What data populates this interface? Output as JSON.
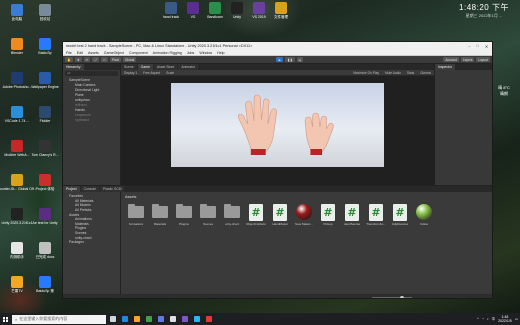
{
  "desktop": {
    "left_icons": [
      {
        "label": "此电脑",
        "color": "#3a7bd5"
      },
      {
        "label": "Blender",
        "color": "#f08a1f"
      },
      {
        "label": "Adobe Photosho...",
        "color": "#1f3b70"
      },
      {
        "label": "VSCode 1.74 ...",
        "color": "#2a8fd8"
      },
      {
        "label": "McAfee WebA...",
        "color": "#c62828"
      },
      {
        "label": "Counter-St... Global Off...",
        "color": "#d9a21b"
      },
      {
        "label": "Unity 2020.3.21f1c1",
        "color": "#222"
      },
      {
        "label": "内测助手",
        "color": "#e6e6e6"
      },
      {
        "label": "芒果TV",
        "color": "#f5a623"
      }
    ],
    "second_icons": [
      {
        "label": "回收站",
        "color": "#7a8a99"
      },
      {
        "label": "BaiduSp",
        "color": "#2979ff"
      },
      {
        "label": "Wallpaper Engine",
        "color": "#2b5aa8"
      },
      {
        "label": "Fiddler",
        "color": "#2c4a6e"
      },
      {
        "label": "Tom Clancy's R...",
        "color": "#333"
      },
      {
        "label": "Project 体验",
        "color": "#c9302c"
      },
      {
        "label": "Ae test for Unity",
        "color": "#5b2d82"
      },
      {
        "label": "已完成 docs",
        "color": "#c0c0c0"
      },
      {
        "label": "BaiduSp 第",
        "color": "#2979ff"
      }
    ],
    "top_icons": [
      {
        "label": "hand track",
        "color": "#3c5a88"
      },
      {
        "label": "VS",
        "color": "#5c2d91"
      },
      {
        "label": "Bandicam",
        "color": "#2a8f4a"
      },
      {
        "label": "Unity",
        "color": "#222"
      },
      {
        "label": "VS 2019",
        "color": "#6a3fa0"
      },
      {
        "label": "文件管理",
        "color": "#d9a21b"
      }
    ],
    "clock_time": "1:48:20 下午",
    "clock_date": "星期三 2022年1月 ...",
    "weather_temp": "晴 8°C",
    "weather_label": "晴朗"
  },
  "unity": {
    "title": "model test 2 hand track - SampleScene - PC, Mac & Linux Standalone - Unity 2020.3.21f1c1 Personal <DX11>",
    "menu": [
      "File",
      "Edit",
      "Assets",
      "GameObject",
      "Component",
      "Animation Rigging",
      "Jobs",
      "Window",
      "Help"
    ],
    "toolbar": {
      "pivot": "Pivot",
      "global": "Global",
      "account": "Account",
      "layers": "Layers",
      "layout": "Layout"
    },
    "hierarchy": {
      "tab": "Hierarchy",
      "search": "All",
      "rows": [
        {
          "label": "SampleScene",
          "indent": false,
          "dim": false
        },
        {
          "label": "Main Camera",
          "indent": true,
          "dim": false
        },
        {
          "label": "Directional Light",
          "indent": true,
          "dim": false
        },
        {
          "label": "Plane",
          "indent": true,
          "dim": false
        },
        {
          "label": "unityuhan",
          "indent": true,
          "dim": false
        },
        {
          "label": "lefthand",
          "indent": true,
          "dim": true
        },
        {
          "label": "Hands",
          "indent": true,
          "dim": false
        },
        {
          "label": "Leapsman",
          "indent": true,
          "dim": true
        },
        {
          "label": "righthand",
          "indent": true,
          "dim": true
        }
      ]
    },
    "scene_tabs": [
      "Scene",
      "Game",
      "Asset Store",
      "Animator"
    ],
    "game_bar": {
      "display": "Display 1",
      "aspect": "Free Aspect",
      "scale": "Scale",
      "maximize": "Maximize On Play",
      "mute": "Mute Audio",
      "stats": "Stats",
      "gizmos": "Gizmos"
    },
    "inspector_tab": "Inspector",
    "project": {
      "tabs": [
        "Project",
        "Console",
        "Plastic SCM"
      ],
      "tree": [
        {
          "label": "Favorites",
          "indent": false
        },
        {
          "label": "All Materials",
          "indent": true
        },
        {
          "label": "All Models",
          "indent": true
        },
        {
          "label": "All Prefabs",
          "indent": true
        },
        {
          "label": "Assets",
          "indent": false
        },
        {
          "label": "Animations",
          "indent": true
        },
        {
          "label": "Materials",
          "indent": true
        },
        {
          "label": "Plugins",
          "indent": true
        },
        {
          "label": "Scenes",
          "indent": true
        },
        {
          "label": "unity-chan!",
          "indent": true
        },
        {
          "label": "Packages",
          "indent": false
        }
      ],
      "header": "Assets",
      "assets": [
        {
          "name": "Animations",
          "kind": "folder"
        },
        {
          "name": "Materials",
          "kind": "folder"
        },
        {
          "name": "Plugins",
          "kind": "folder"
        },
        {
          "name": "Scenes",
          "kind": "folder"
        },
        {
          "name": "unity-chan!",
          "kind": "folder"
        },
        {
          "name": "ObjectCollision",
          "kind": "script"
        },
        {
          "name": "HandModel",
          "kind": "script"
        },
        {
          "name": "New Materi...",
          "kind": "sphere",
          "color": "#9b1b1b"
        },
        {
          "name": "Pickup",
          "kind": "script"
        },
        {
          "name": "HandSender",
          "kind": "script"
        },
        {
          "name": "TransformFo...",
          "kind": "script"
        },
        {
          "name": "UdpReceive",
          "kind": "script"
        },
        {
          "name": "Yellow",
          "kind": "sphere",
          "color": "#8bc34a"
        }
      ]
    }
  },
  "taskbar": {
    "search": "在这里输入你要搜索的内容",
    "apps": [
      {
        "name": "task-view",
        "color": "#cfd8dc"
      },
      {
        "name": "edge",
        "color": "#1e88e5"
      },
      {
        "name": "explorer",
        "color": "#f9a825"
      },
      {
        "name": "chrome",
        "color": "#43a047"
      },
      {
        "name": "store",
        "color": "#5e7ce2"
      },
      {
        "name": "unity",
        "color": "#e0e0e0"
      },
      {
        "name": "vs",
        "color": "#7e57c2"
      },
      {
        "name": "vscode",
        "color": "#29b6f6"
      },
      {
        "name": "bandicam",
        "color": "#e53935"
      }
    ],
    "time": "1:48",
    "date": "2022/1/5",
    "lang": "中"
  }
}
